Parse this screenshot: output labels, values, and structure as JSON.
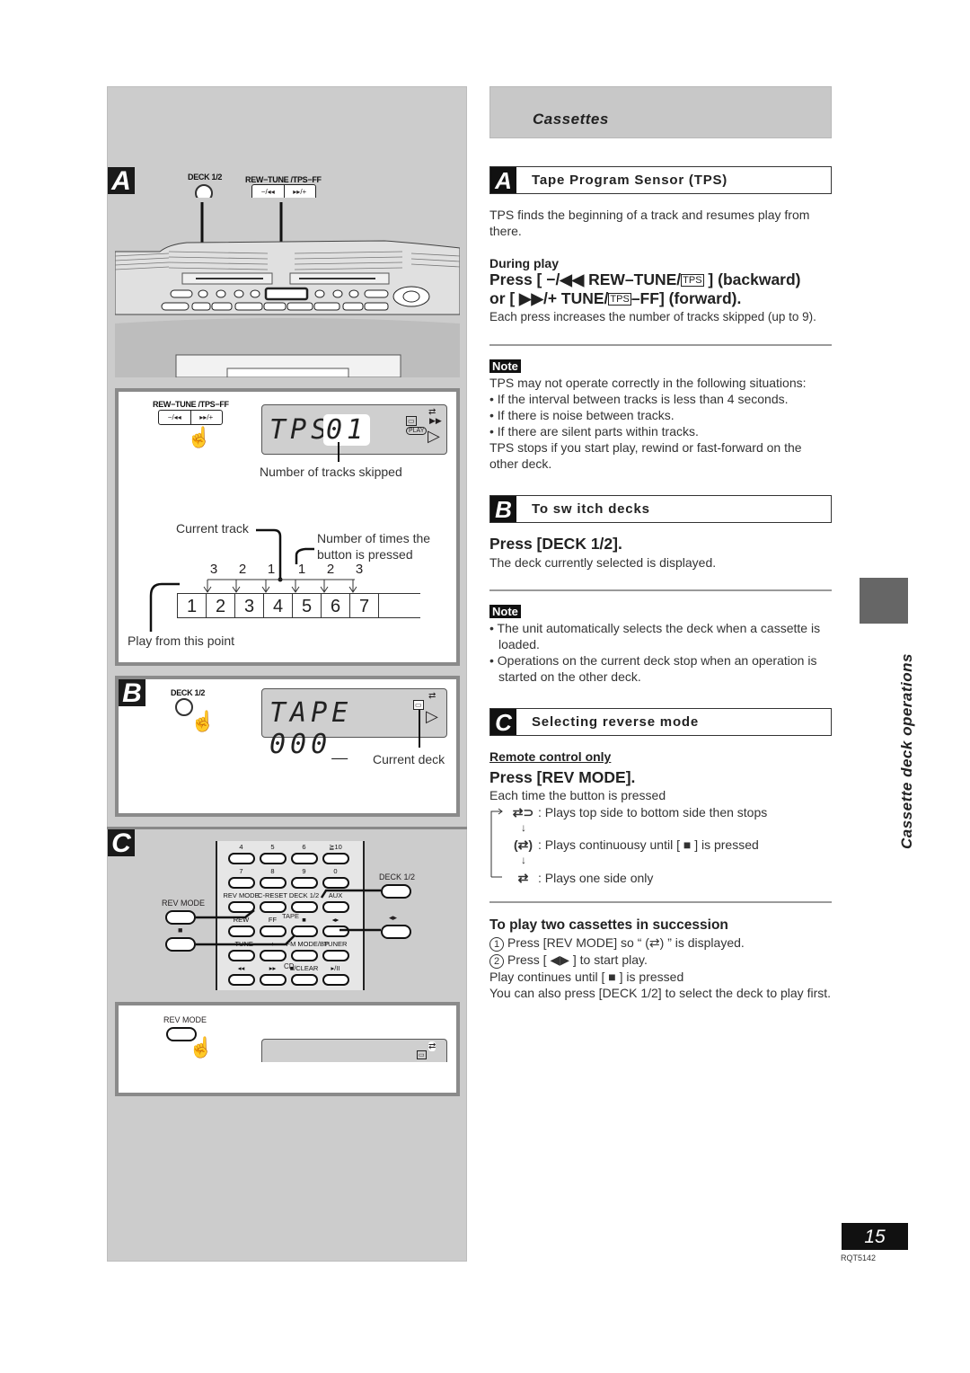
{
  "header": {
    "title": "Cassettes"
  },
  "side_tab": {
    "label": "Cassette deck operations"
  },
  "footer": {
    "page_number": "15",
    "doc_code": "RQT5142"
  },
  "illustrations": {
    "A": {
      "badge": "A",
      "deck_label": "DECK 1/2",
      "rew_tune_label": "REW−TUNE /TPS−FF",
      "rew_button": "−/◂◂",
      "ff_button": "▸▸/+",
      "lcd_text": "TPS+",
      "lcd_digits": "01",
      "lcd_play_label": "PLAY",
      "caption_tracks_skipped": "Number of tracks skipped",
      "caption_current_track": "Current track",
      "caption_times_pressed": "Number of times the button is pressed",
      "caption_play_from": "Play from this point",
      "press_counts_back": [
        "3",
        "2",
        "1"
      ],
      "press_counts_fwd": [
        "1",
        "2",
        "3"
      ],
      "tracks": [
        "1",
        "2",
        "3",
        "4",
        "5",
        "6",
        "7"
      ]
    },
    "B": {
      "badge": "B",
      "deck_label": "DECK 1/2",
      "lcd_text": "TAPE 000_",
      "caption_current_deck": "Current deck"
    },
    "C": {
      "badge": "C",
      "rev_mode_label": "REV MODE",
      "stop_label": "■",
      "deck_label": "DECK 1/2",
      "play_label": "◂▸",
      "remote_rows": [
        [
          "4",
          "5",
          "6",
          "≧10"
        ],
        [
          "7",
          "8",
          "9",
          "0"
        ],
        [
          "REV MODE",
          "C-RESET",
          "DECK 1/2",
          "AUX"
        ],
        [
          "REW",
          "FF",
          "■",
          "◂▸"
        ],
        [
          "− TUNE",
          "+",
          "FM MODE/BP",
          "TUNER"
        ],
        [
          "◂◂",
          "▸▸",
          "■/CLEAR",
          "▸/II"
        ]
      ],
      "remote_group_tape": "TAPE",
      "remote_group_cd": "CD",
      "remote_tps": "TPS",
      "bottom_rev_mode_label": "REV MODE"
    }
  },
  "sections": {
    "A": {
      "badge": "A",
      "title": "Tape Program Sensor (TPS)",
      "intro": "TPS finds the beginning of a track and resumes play from there.",
      "during_play": "During play",
      "press_line1_a": "Press [ −/◀◀ REW–TUNE/",
      "press_line1_tps": "TPS",
      "press_line1_b": " ] (backward)",
      "press_line2_a": "or [ ▶▶/+ TUNE/",
      "press_line2_tps": "TPS",
      "press_line2_b": "–FF] (forward).",
      "press_detail": "Each press increases the number of tracks skipped (up to 9).",
      "note_label": "Note",
      "note_intro": "TPS may not operate correctly in the following situations:",
      "note_bullets": [
        "If the interval between tracks is less than 4 seconds.",
        "If there is noise between tracks.",
        "If there are silent parts within tracks."
      ],
      "note_outro": "TPS stops if you start play, rewind or fast-forward on the other deck."
    },
    "B": {
      "badge": "B",
      "title": "To sw itch decks",
      "press": "Press [DECK 1/2].",
      "detail": "The deck currently selected is displayed.",
      "note_label": "Note",
      "note_bullets": [
        "The unit automatically selects the deck when a cassette is loaded.",
        "Operations on the current deck stop when an operation is started on the other deck."
      ]
    },
    "C": {
      "badge": "C",
      "title": "Selecting reverse mode",
      "remote_only": "Remote control only",
      "press": "Press [REV MODE].",
      "detail": "Each time the button is pressed",
      "modes": [
        {
          "icon": "⇄⊃",
          "text": ": Plays top side to bottom side then stops"
        },
        {
          "icon": "(⇄)",
          "text": ": Plays continuousy until [ ■ ] is pressed"
        },
        {
          "icon": "⇄",
          "text": ": Plays one side only"
        }
      ],
      "succession_title": "To play two cassettes in succession",
      "steps": [
        {
          "num": "1",
          "text": "Press [REV MODE] so “ (⇄) ” is displayed."
        },
        {
          "num": "2",
          "text": "Press [ ◀▶ ] to start play."
        }
      ],
      "outro1": "Play continues until [ ■ ] is pressed",
      "outro2": "You can also press [DECK 1/2] to select the deck to play first."
    }
  }
}
